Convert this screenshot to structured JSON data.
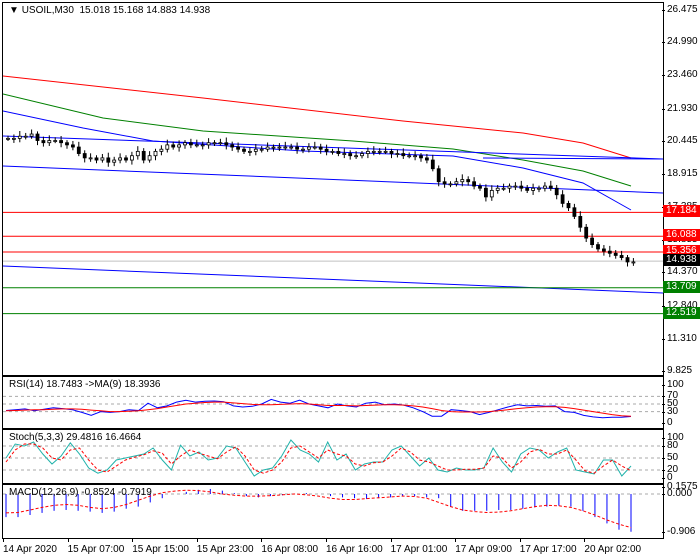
{
  "header": {
    "symbol": "USOIL,M30",
    "ohlc": "15.018 15.168 14.883 14.938"
  },
  "price_axis": [
    "26.475",
    "24.990",
    "23.460",
    "21.930",
    "20.445",
    "18.915",
    "17.385",
    "15.855",
    "14.370",
    "12.840",
    "11.310",
    "9.825"
  ],
  "price_labels": [
    {
      "text": "17.184",
      "value": 17.184,
      "color": "#ff0000"
    },
    {
      "text": "16.088",
      "value": 16.088,
      "color": "#ff0000"
    },
    {
      "text": "15.356",
      "value": 15.356,
      "color": "#ff0000"
    },
    {
      "text": "14.938",
      "value": 14.938,
      "color": "#000000"
    },
    {
      "text": "13.709",
      "value": 13.709,
      "color": "#008000"
    },
    {
      "text": "12.519",
      "value": 12.519,
      "color": "#008000"
    }
  ],
  "closes": [
    20.6,
    20.6,
    20.7,
    20.7,
    20.8,
    20.5,
    20.4,
    20.5,
    20.5,
    20.4,
    20.3,
    20.2,
    19.9,
    19.7,
    19.7,
    19.6,
    19.7,
    19.5,
    19.6,
    19.7,
    19.6,
    19.8,
    20.0,
    19.6,
    19.8,
    20.0,
    20.1,
    20.3,
    20.2,
    20.3,
    20.4,
    20.3,
    20.3,
    20.3,
    20.4,
    20.4,
    20.4,
    20.3,
    20.2,
    20.1,
    20.0,
    20.0,
    20.1,
    20.1,
    20.2,
    20.2,
    20.2,
    20.2,
    20.2,
    20.1,
    20.1,
    20.2,
    20.2,
    20.1,
    20.0,
    20.0,
    19.9,
    19.9,
    19.8,
    19.8,
    19.9,
    20.0,
    20.0,
    20.0,
    20.0,
    19.9,
    19.9,
    19.8,
    19.8,
    19.8,
    19.7,
    19.6,
    19.2,
    18.6,
    18.5,
    18.5,
    18.6,
    18.7,
    18.6,
    18.4,
    18.3,
    17.9,
    18.2,
    18.3,
    18.3,
    18.4,
    18.4,
    18.3,
    18.2,
    18.3,
    18.3,
    18.4,
    18.3,
    18.0,
    17.6,
    17.4,
    17.0,
    16.5,
    16.0,
    15.7,
    15.5,
    15.4,
    15.3,
    15.2,
    15.1,
    14.9,
    14.9
  ],
  "rsi": {
    "label": "RSI(14) 18.7483  ->MA(9) 18.3936",
    "axis": [
      "100",
      "70",
      "50",
      "30",
      "0"
    ],
    "values": [
      33,
      35,
      37,
      32,
      36,
      40,
      38,
      35,
      28,
      20,
      30,
      28,
      30,
      35,
      33,
      52,
      40,
      45,
      55,
      60,
      55,
      57,
      58,
      56,
      45,
      42,
      44,
      50,
      62,
      55,
      52,
      60,
      50,
      45,
      40,
      50,
      45,
      42,
      52,
      55,
      48,
      50,
      47,
      40,
      30,
      18,
      18,
      35,
      33,
      30,
      22,
      28,
      35,
      42,
      48,
      45,
      46,
      44,
      45,
      30,
      28,
      20,
      16,
      14,
      15,
      15,
      17
    ],
    "ma": [
      32,
      33,
      34,
      35,
      35,
      36,
      37,
      37,
      36,
      34,
      32,
      30,
      30,
      31,
      32,
      35,
      38,
      42,
      46,
      50,
      52,
      54,
      55,
      55,
      53,
      51,
      49,
      48,
      48,
      49,
      50,
      51,
      50,
      48,
      46,
      46,
      46,
      45,
      46,
      47,
      48,
      48,
      47,
      45,
      42,
      38,
      33,
      30,
      29,
      29,
      29,
      30,
      32,
      35,
      38,
      40,
      42,
      43,
      43,
      41,
      38,
      34,
      30,
      26,
      22,
      19,
      18
    ]
  },
  "stoch": {
    "label": "Stoch(5,3,3) 29.4816 16.4664",
    "axis": [
      "100",
      "80",
      "50",
      "20",
      "0"
    ],
    "k": [
      50,
      85,
      80,
      90,
      60,
      35,
      55,
      88,
      60,
      25,
      12,
      20,
      45,
      50,
      55,
      60,
      75,
      45,
      20,
      82,
      55,
      65,
      45,
      50,
      80,
      75,
      40,
      5,
      20,
      25,
      55,
      95,
      70,
      60,
      40,
      90,
      45,
      60,
      20,
      35,
      40,
      40,
      70,
      80,
      55,
      30,
      50,
      20,
      15,
      25,
      20,
      20,
      25,
      75,
      40,
      15,
      60,
      75,
      70,
      50,
      65,
      75,
      20,
      15,
      10,
      45,
      45,
      5,
      30
    ],
    "d": [
      40,
      70,
      85,
      85,
      75,
      50,
      45,
      70,
      75,
      45,
      20,
      15,
      30,
      45,
      52,
      58,
      68,
      62,
      35,
      55,
      70,
      62,
      55,
      48,
      65,
      78,
      55,
      20,
      12,
      20,
      40,
      75,
      80,
      65,
      50,
      70,
      60,
      55,
      35,
      30,
      38,
      40,
      55,
      75,
      65,
      45,
      40,
      30,
      20,
      20,
      22,
      22,
      25,
      55,
      50,
      25,
      40,
      65,
      72,
      60,
      60,
      70,
      45,
      18,
      12,
      30,
      45,
      30,
      18
    ]
  },
  "macd": {
    "label": "MACD(12,26,9) -0.8524 -0.7919",
    "axis": [
      "0.1575",
      "0.000",
      "-0.906"
    ],
    "hist": [
      -0.55,
      -0.55,
      -0.5,
      -0.45,
      -0.4,
      -0.38,
      -0.4,
      -0.42,
      -0.45,
      -0.42,
      -0.35,
      -0.3,
      -0.2,
      -0.1,
      0.0,
      0.05,
      0.1,
      0.12,
      0.08,
      0.02,
      -0.05,
      -0.08,
      -0.05,
      -0.03,
      0.0,
      0.02,
      0.0,
      -0.05,
      -0.08,
      -0.1,
      -0.12,
      -0.1,
      -0.08,
      -0.05,
      -0.05,
      -0.08,
      -0.1,
      -0.3,
      -0.4,
      -0.4,
      -0.4,
      -0.38,
      -0.38,
      -0.35,
      -0.32,
      -0.3,
      -0.28,
      -0.3,
      -0.4,
      -0.55,
      -0.7,
      -0.85,
      -0.9
    ],
    "signal": [
      -0.45,
      -0.44,
      -0.38,
      -0.32,
      -0.27,
      -0.25,
      -0.27,
      -0.32,
      -0.35,
      -0.32,
      -0.25,
      -0.15,
      -0.05,
      0.03,
      0.07,
      0.09,
      0.08,
      0.05,
      0.0,
      -0.03,
      -0.05,
      -0.05,
      -0.04,
      -0.02,
      0.0,
      -0.02,
      -0.05,
      -0.1,
      -0.13,
      -0.13,
      -0.11,
      -0.09,
      -0.07,
      -0.05,
      -0.06,
      -0.1,
      -0.2,
      -0.3,
      -0.38,
      -0.42,
      -0.44,
      -0.43,
      -0.4,
      -0.35,
      -0.3,
      -0.27,
      -0.28,
      -0.32,
      -0.4,
      -0.5,
      -0.62,
      -0.72,
      -0.8
    ]
  },
  "time_axis": [
    "14 Apr 2020",
    "15 Apr 07:00",
    "15 Apr 15:00",
    "15 Apr 23:00",
    "16 Apr 08:00",
    "16 Apr 16:00",
    "17 Apr 01:00",
    "17 Apr 09:00",
    "17 Apr 17:00",
    "20 Apr 02:00"
  ]
}
